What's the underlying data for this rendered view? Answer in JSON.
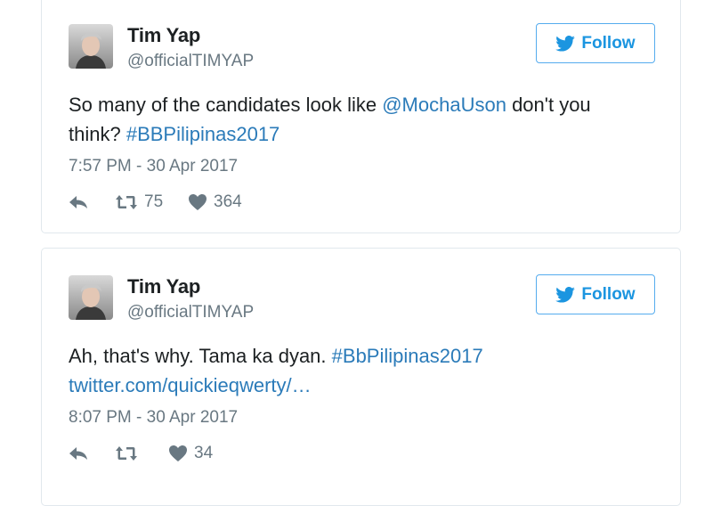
{
  "colors": {
    "link": "#2b7bb9",
    "follow_accent": "#1b95e0",
    "text": "#1c2022",
    "muted": "#697882",
    "border": "#e1e8ed"
  },
  "tweets": [
    {
      "author_name": "Tim Yap",
      "author_handle": "@officialTIMYAP",
      "avatar_icon": "profile-photo",
      "follow_label": "Follow",
      "text_part1": "So many of the candidates look like ",
      "mention": "@MochaUson",
      "text_part2": " don't you think? ",
      "hashtag": "#BBPilipinas2017",
      "timestamp": "7:57 PM - 30 Apr 2017",
      "retweets": "75",
      "likes": "364"
    },
    {
      "author_name": "Tim Yap",
      "author_handle": "@officialTIMYAP",
      "avatar_icon": "profile-photo",
      "follow_label": "Follow",
      "text_part1": "Ah, that's why. Tama ka dyan. ",
      "hashtag": "#BbPilipinas2017",
      "link": "twitter.com/quickieqwerty/…",
      "timestamp": "8:07 PM - 30 Apr 2017",
      "retweets": "",
      "likes": "34"
    }
  ]
}
